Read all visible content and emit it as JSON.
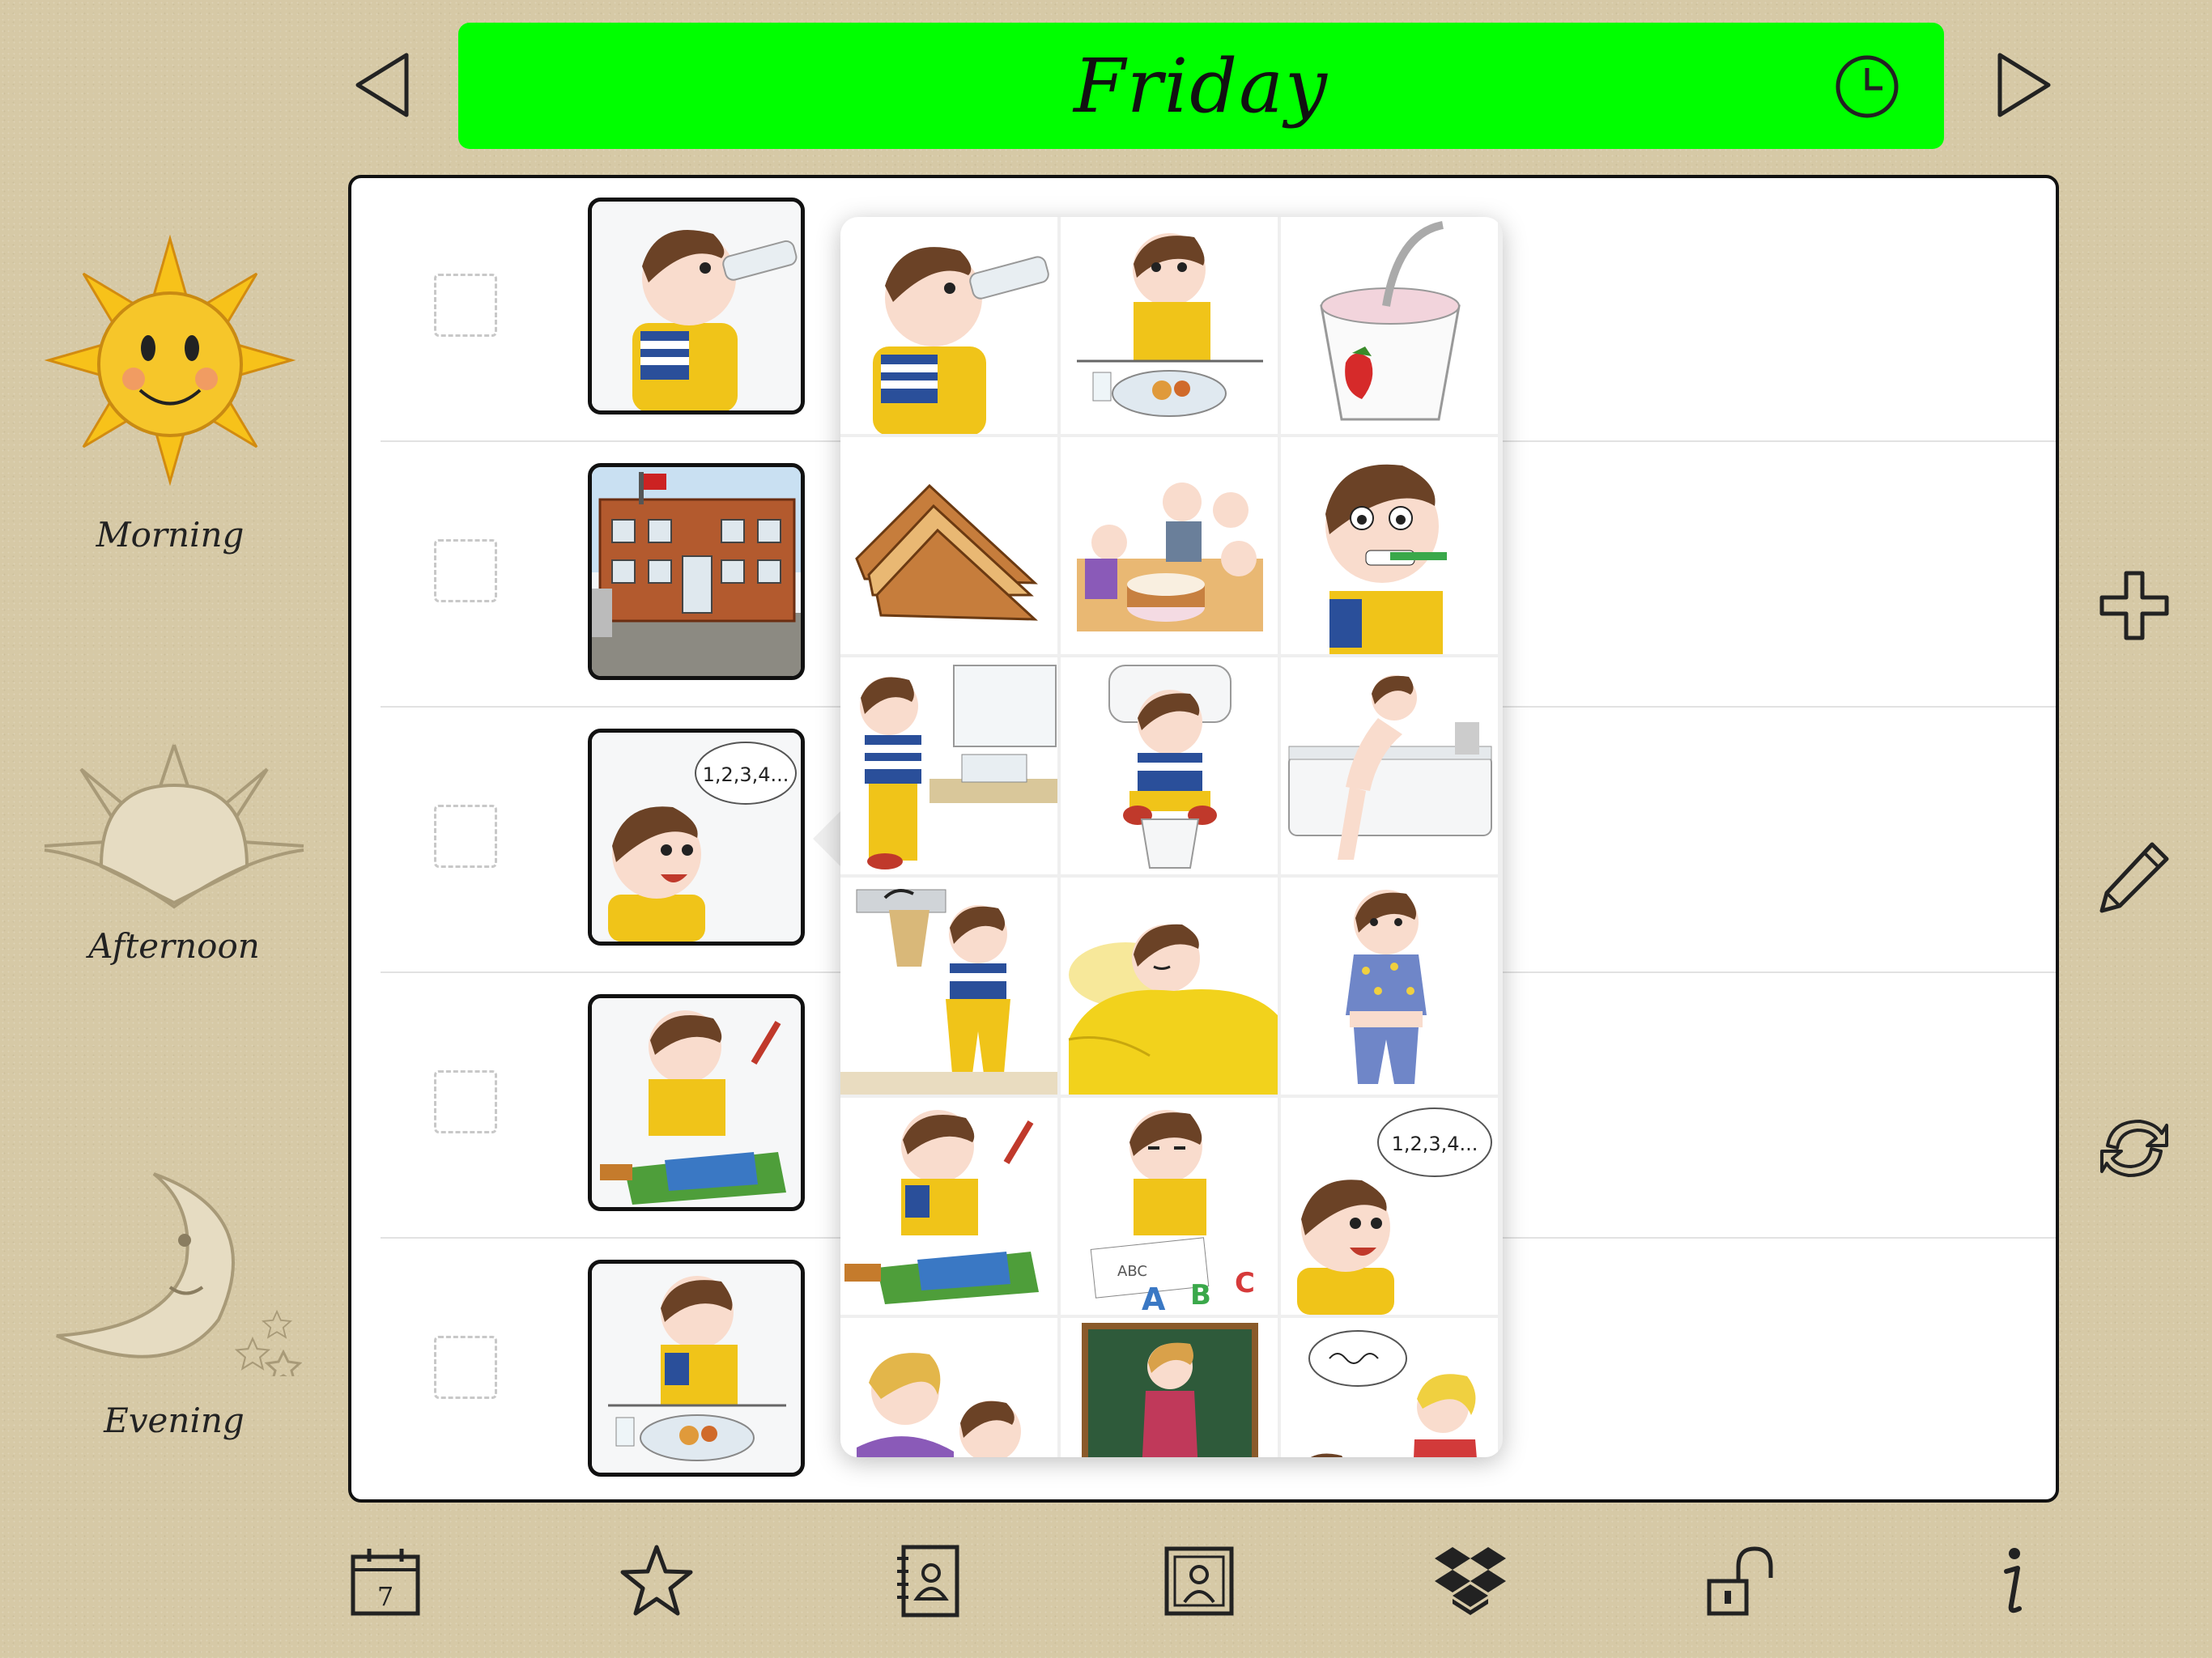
{
  "header": {
    "day": "Friday",
    "background_color": "#00ff00",
    "prev_icon": "triangle-left-icon",
    "next_icon": "triangle-right-icon",
    "clock_icon": "clock-icon"
  },
  "time_of_day": [
    {
      "label": "Morning",
      "icon": "sun-icon"
    },
    {
      "label": "Afternoon",
      "icon": "setting-sun-icon"
    },
    {
      "label": "Evening",
      "icon": "moon-icon"
    }
  ],
  "schedule_rows": [
    {
      "picture": "boy-drinking"
    },
    {
      "picture": "school-building"
    },
    {
      "picture": "boy-counting"
    },
    {
      "picture": "boy-painting"
    },
    {
      "picture": "boy-eating"
    }
  ],
  "picker": {
    "pictures": [
      {
        "name": "boy-drinking"
      },
      {
        "name": "boy-eating"
      },
      {
        "name": "yogurt"
      },
      {
        "name": "toast"
      },
      {
        "name": "birthday-party"
      },
      {
        "name": "brushing-teeth"
      },
      {
        "name": "washing-hands"
      },
      {
        "name": "toilet"
      },
      {
        "name": "bath"
      },
      {
        "name": "getting-dressed"
      },
      {
        "name": "sleeping"
      },
      {
        "name": "pajamas"
      },
      {
        "name": "painting"
      },
      {
        "name": "writing-abc"
      },
      {
        "name": "counting",
        "bubble_text": "1,2,3,4..."
      },
      {
        "name": "mother-and-boy"
      },
      {
        "name": "teacher-blackboard"
      },
      {
        "name": "teacher-talking"
      }
    ],
    "counting_bubble": "1,2,3,4..."
  },
  "right_toolbar": [
    {
      "icon": "plus-icon"
    },
    {
      "icon": "pencil-icon"
    },
    {
      "icon": "sync-icon"
    }
  ],
  "bottom_toolbar": [
    {
      "icon": "calendar-icon",
      "text": "7"
    },
    {
      "icon": "star-icon"
    },
    {
      "icon": "contacts-book-icon"
    },
    {
      "icon": "photo-frame-icon"
    },
    {
      "icon": "dropbox-icon"
    },
    {
      "icon": "unlock-icon"
    },
    {
      "icon": "info-icon"
    }
  ]
}
